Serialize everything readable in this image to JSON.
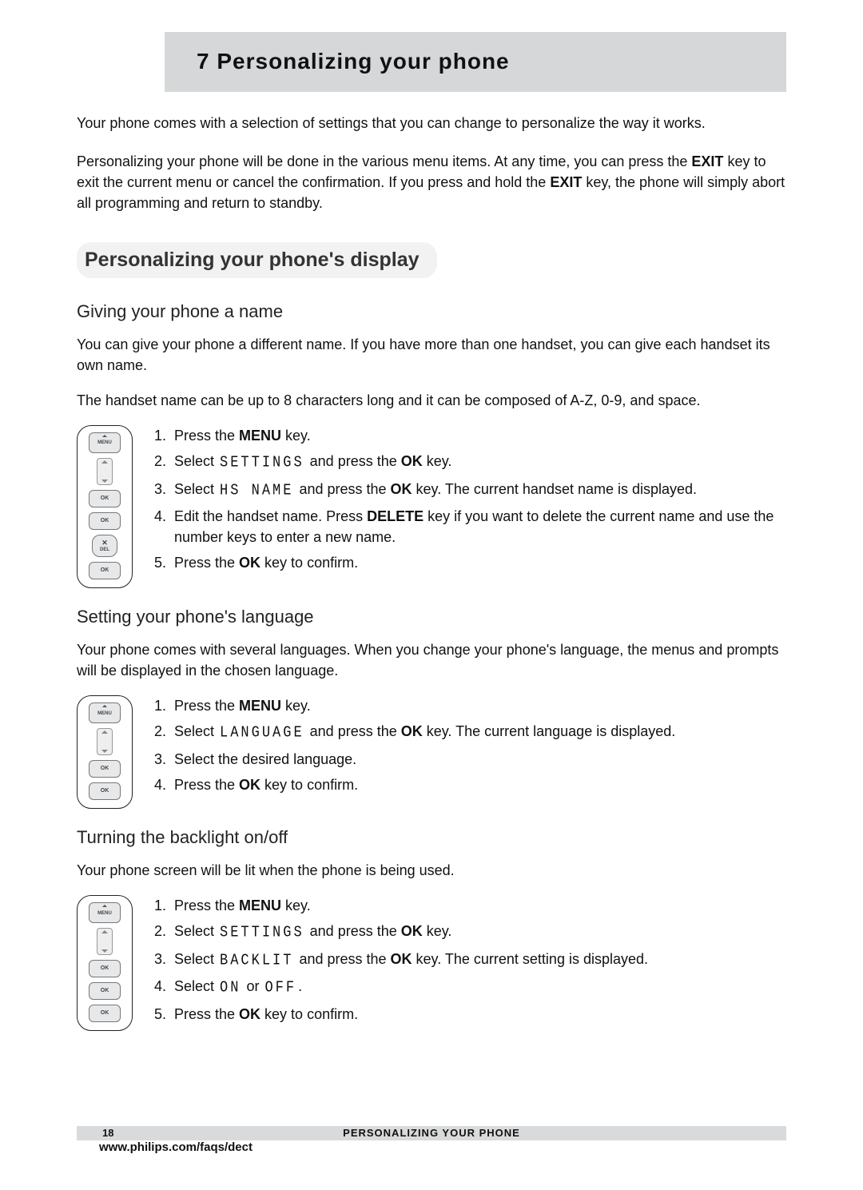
{
  "chapter_number": "7",
  "chapter_title": "Personalizing your phone",
  "title_combined": "7   Personalizing your phone",
  "intro_p1": "Your phone comes with a selection of settings that you can change to personalize the way it works.",
  "intro_p2_a": "Personalizing your phone will be done in the various menu items.  At any time, you can press the ",
  "intro_p2_b": " key to exit the current menu or cancel the confirmation.  If you press and hold the ",
  "intro_p2_c": " key, the phone will simply abort all programming and return to standby.",
  "key_exit": "EXIT",
  "section1_title": "Personalizing your phone's display",
  "sec1": {
    "h": "Giving your phone a name",
    "p1": "You can give your phone a different name.  If you have more than one handset, you can give each handset its own name.",
    "p2": "The handset name can be up to 8 characters long and it can be composed of A-Z, 0-9, and space.",
    "s1_a": "Press the ",
    "s1_key": "MENU",
    "s1_b": " key.",
    "s2_a": "Select ",
    "s2_seg": "SETTINGS",
    "s2_b": " and press the ",
    "s2_key": "OK",
    "s2_c": " key.",
    "s3_a": "Select ",
    "s3_seg": "HS NAME",
    "s3_b": " and press the ",
    "s3_key": "OK",
    "s3_c": " key.  The current handset name is displayed.",
    "s4_a": "Edit the handset name.  Press ",
    "s4_key": "DELETE",
    "s4_b": " key if you want to delete the current name and use the number keys to enter a new name.",
    "s5_a": "Press the ",
    "s5_key": "OK",
    "s5_b": " key to confirm."
  },
  "sec2": {
    "h": "Setting your phone's language",
    "p1": "Your phone comes with several languages.  When you change your phone's language, the menus and prompts will be displayed in the chosen language.",
    "s1_a": "Press the ",
    "s1_key": "MENU",
    "s1_b": " key.",
    "s2_a": "Select ",
    "s2_seg": "LANGUAGE",
    "s2_b": " and press the ",
    "s2_key": "OK",
    "s2_c": " key.  The current language is displayed.",
    "s3": "Select the desired language.",
    "s4_a": "Press the ",
    "s4_key": "OK",
    "s4_b": " key to confirm."
  },
  "sec3": {
    "h": "Turning the backlight on/off",
    "p1": "Your phone screen will be lit when the phone is being used.",
    "s1_a": "Press the ",
    "s1_key": "MENU",
    "s1_b": " key.",
    "s2_a": "Select ",
    "s2_seg": "SETTINGS",
    "s2_b": " and press the ",
    "s2_key": "OK",
    "s2_c": " key.",
    "s3_a": "Select ",
    "s3_seg": "BACKLIT",
    "s3_b": " and press the ",
    "s3_key": "OK",
    "s3_c": " key.  The current setting is displayed.",
    "s4_a": "Select ",
    "s4_seg1": "ON",
    "s4_b": " or ",
    "s4_seg2": "OFF",
    "s4_c": ".",
    "s5_a": "Press the ",
    "s5_key": "OK",
    "s5_b": " key to confirm."
  },
  "footer": {
    "page": "18",
    "running": "PERSONALIZING YOUR PHONE",
    "url": "www.philips.com/faqs/dect"
  }
}
